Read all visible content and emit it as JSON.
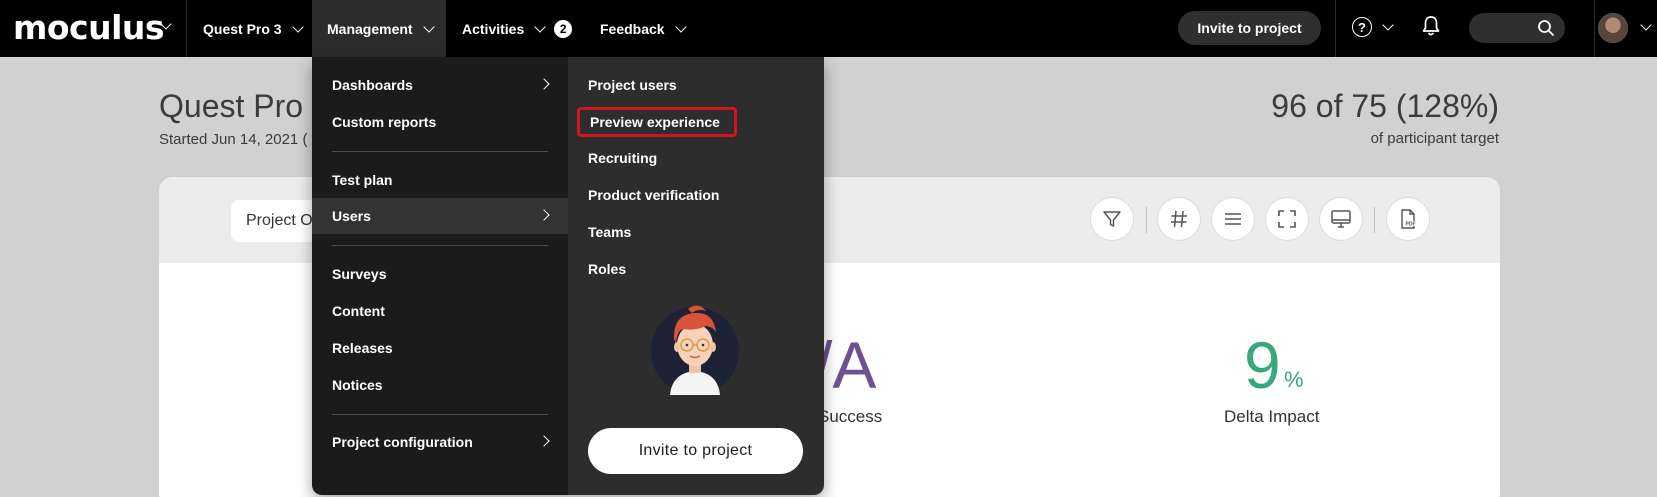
{
  "navbar": {
    "brand": "moculus",
    "items": [
      {
        "label": "Quest Pro 3"
      },
      {
        "label": "Management"
      },
      {
        "label": "Activities",
        "badge": "2"
      },
      {
        "label": "Feedback"
      }
    ],
    "invite_label": "Invite to project",
    "help_glyph": "?"
  },
  "page": {
    "title": "Quest Pro",
    "subtitle": "Started Jun 14, 2021 (",
    "target_value": "96 of 75 (128%)",
    "target_caption": "of participant target"
  },
  "card": {
    "project_button": "Project O",
    "metrics": [
      {
        "value": "/A",
        "label": "Success",
        "color": "#6e5193"
      },
      {
        "value": "9",
        "unit": "%",
        "label": "Delta Impact",
        "color": "#36a87a"
      }
    ],
    "tools": [
      "filter-icon",
      "hash-icon",
      "list-icon",
      "fullscreen-icon",
      "monitor-icon",
      "pdf-icon"
    ]
  },
  "menu": {
    "left": [
      {
        "label": "Dashboards",
        "submenu": true
      },
      {
        "label": "Custom reports"
      },
      {
        "label": "Test plan"
      },
      {
        "label": "Users",
        "submenu": true,
        "highlighted": true
      },
      {
        "label": "Surveys"
      },
      {
        "label": "Content"
      },
      {
        "label": "Releases"
      },
      {
        "label": "Notices"
      },
      {
        "label": "Project configuration",
        "submenu": true
      }
    ],
    "right": [
      {
        "label": "Project users"
      },
      {
        "label": "Preview experience",
        "highlighted": true
      },
      {
        "label": "Recruiting"
      },
      {
        "label": "Product verification"
      },
      {
        "label": "Teams"
      },
      {
        "label": "Roles"
      }
    ],
    "invite_label": "Invite to project"
  },
  "colors": {
    "navbar_bg": "#000000",
    "menu_left_bg": "#1b1b1b",
    "menu_right_bg": "#2d2d2d",
    "highlight_border": "#d3141b",
    "success_purple": "#6e5193",
    "impact_green": "#36a87a"
  }
}
